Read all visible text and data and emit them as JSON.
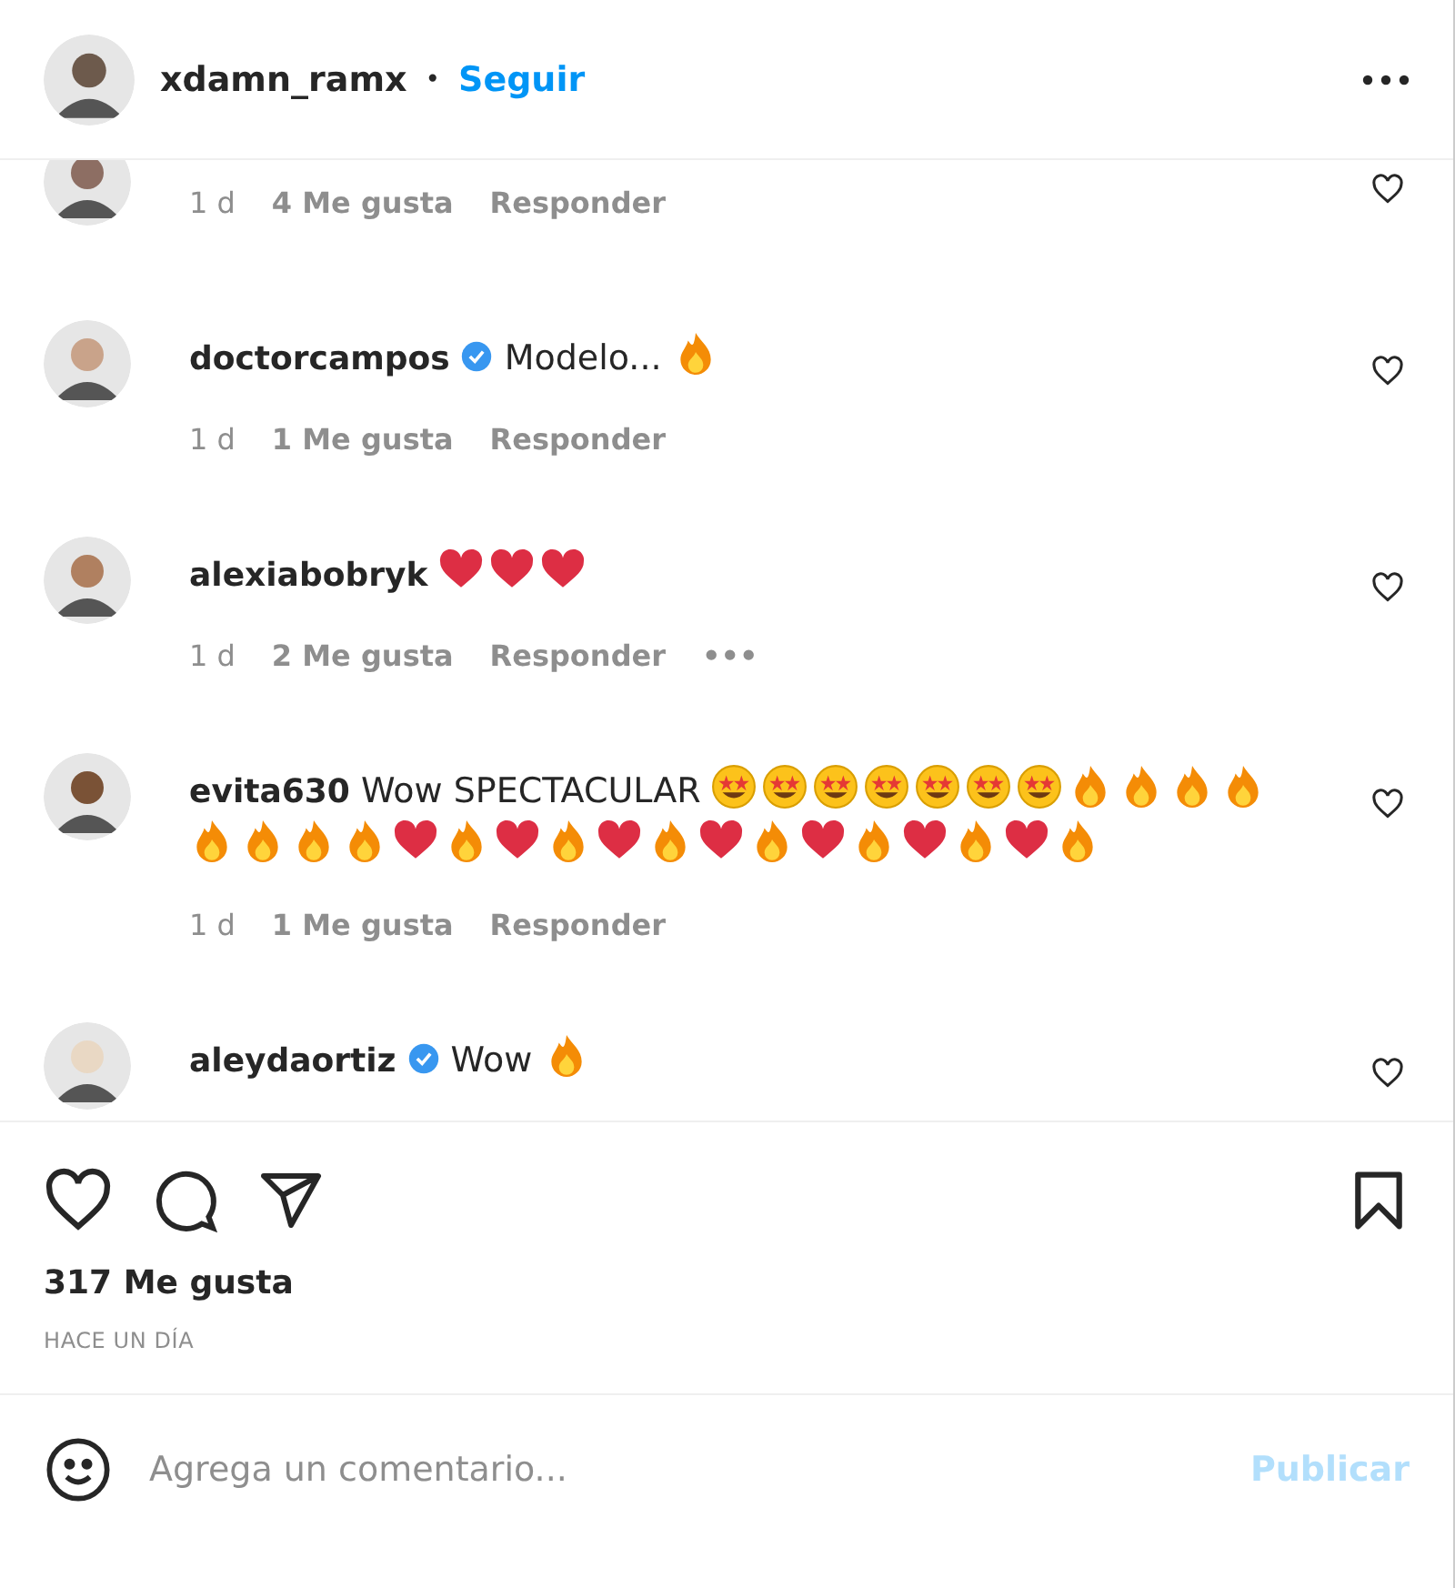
{
  "header": {
    "username": "xdamn_ramx",
    "separator": "•",
    "follow": "Seguir"
  },
  "comments": [
    {
      "age": "1 d",
      "likes": "4 Me gusta",
      "reply": "Responder"
    },
    {
      "user": "doctorcampos",
      "verified": true,
      "text": "Modelo...",
      "emoji": [
        {
          "kind": "fire"
        }
      ],
      "age": "1 d",
      "likes": "1 Me gusta",
      "reply": "Responder"
    },
    {
      "user": "alexiabobryk",
      "verified": false,
      "emoji": [
        {
          "kind": "heart"
        },
        {
          "kind": "heart"
        },
        {
          "kind": "heart"
        }
      ],
      "age": "1 d",
      "likes": "2 Me gusta",
      "reply": "Responder",
      "more": "•••"
    },
    {
      "user": "evita630",
      "verified": false,
      "text": "Wow SPECTACULAR",
      "emoji": [
        {
          "kind": "star_eyes"
        },
        {
          "kind": "star_eyes"
        },
        {
          "kind": "star_eyes"
        },
        {
          "kind": "star_eyes"
        },
        {
          "kind": "star_eyes"
        },
        {
          "kind": "star_eyes"
        },
        {
          "kind": "star_eyes"
        },
        {
          "kind": "fire"
        },
        {
          "kind": "fire"
        },
        {
          "kind": "fire"
        },
        {
          "kind": "fire"
        },
        {
          "kind": "fire"
        },
        {
          "kind": "fire"
        },
        {
          "kind": "fire"
        },
        {
          "kind": "fire"
        },
        {
          "kind": "heart"
        },
        {
          "kind": "fire"
        },
        {
          "kind": "heart"
        },
        {
          "kind": "fire"
        },
        {
          "kind": "heart"
        },
        {
          "kind": "fire"
        },
        {
          "kind": "heart"
        },
        {
          "kind": "fire"
        },
        {
          "kind": "heart"
        },
        {
          "kind": "fire"
        },
        {
          "kind": "heart"
        },
        {
          "kind": "fire"
        },
        {
          "kind": "heart"
        },
        {
          "kind": "fire"
        }
      ],
      "age": "1 d",
      "likes": "1 Me gusta",
      "reply": "Responder"
    },
    {
      "user": "aleydaortiz",
      "verified": true,
      "text": "Wow",
      "emoji": [
        {
          "kind": "fire"
        }
      ]
    }
  ],
  "likes": "317 Me gusta",
  "time": "HACE UN DÍA",
  "composer": {
    "placeholder": "Agrega un comentario...",
    "submit": "Publicar",
    "disabled": true
  }
}
